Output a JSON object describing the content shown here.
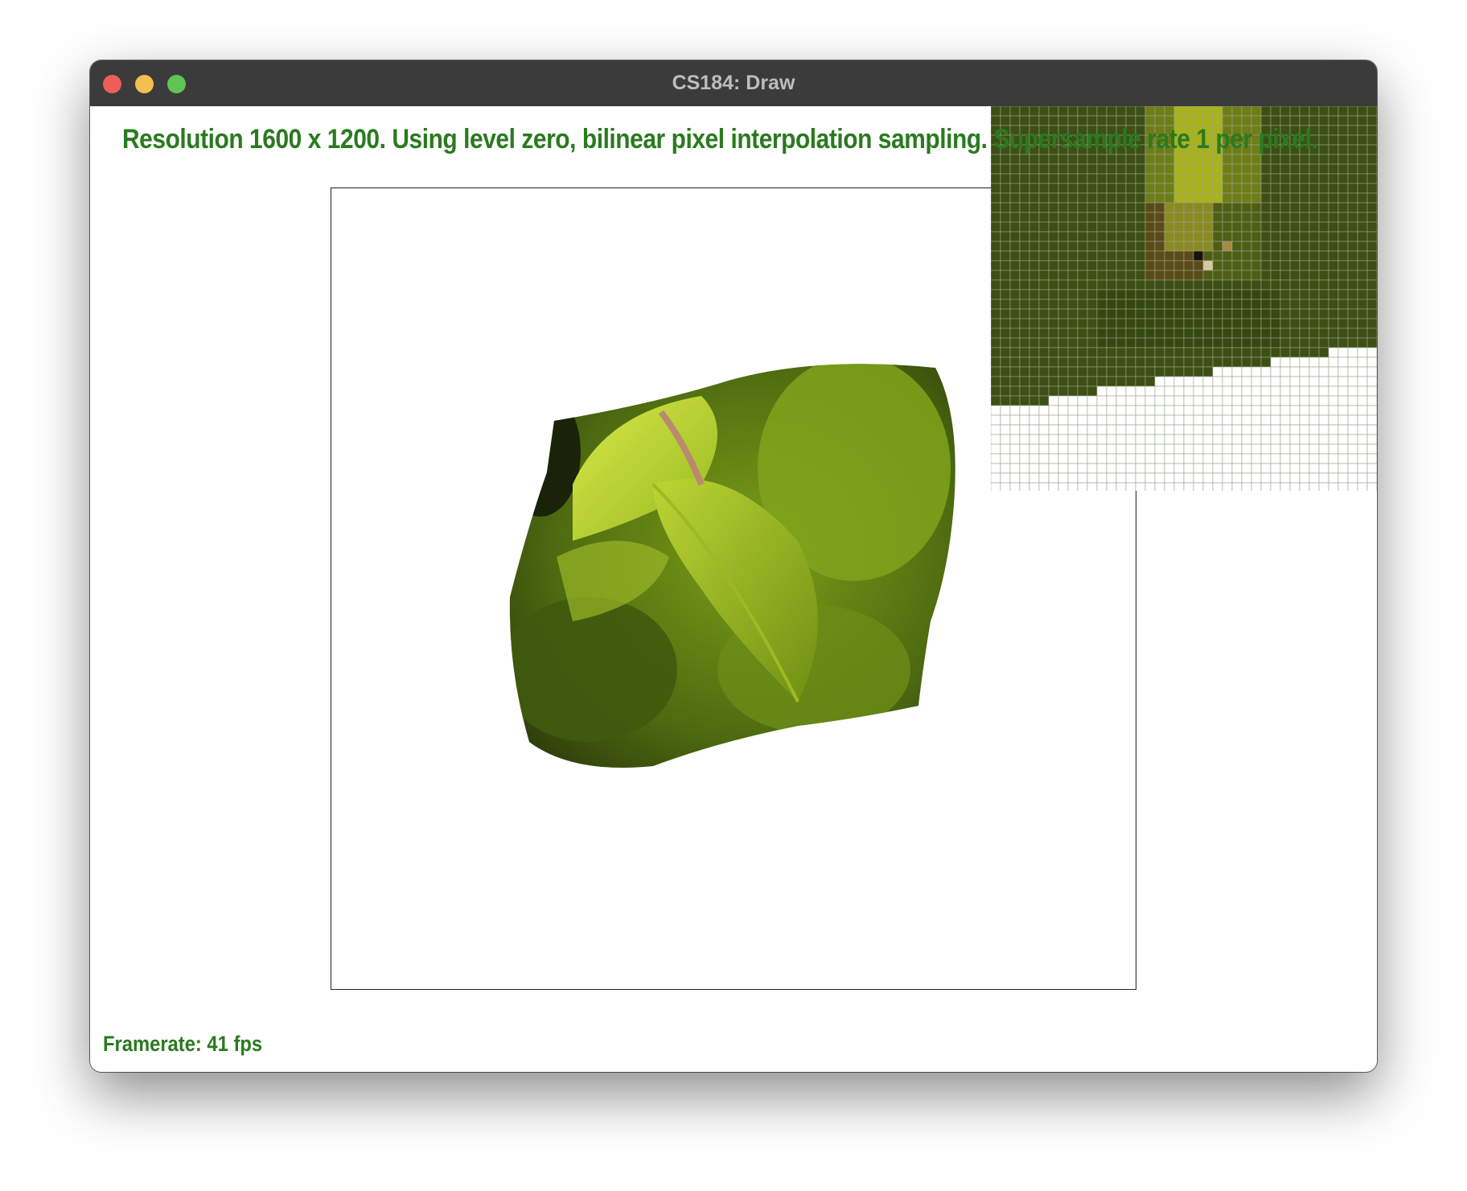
{
  "window": {
    "title": "CS184: Draw"
  },
  "overlay": {
    "status": "Resolution 1600 x 1200. Using level zero, bilinear pixel interpolation sampling. Supersample rate 1 per pixel.",
    "framerate": "Framerate: 41 fps"
  },
  "colors": {
    "overlay_text": "#2a7a1f",
    "titlebar": "#3b3b3b",
    "leaf_light": "#c7dc3a",
    "leaf_mid": "#84a818",
    "leaf_dark": "#2f3d0a",
    "zoom_background": "#3c4f14"
  },
  "icons": {
    "close": "red-circle",
    "minimize": "yellow-circle",
    "zoom": "green-circle"
  }
}
